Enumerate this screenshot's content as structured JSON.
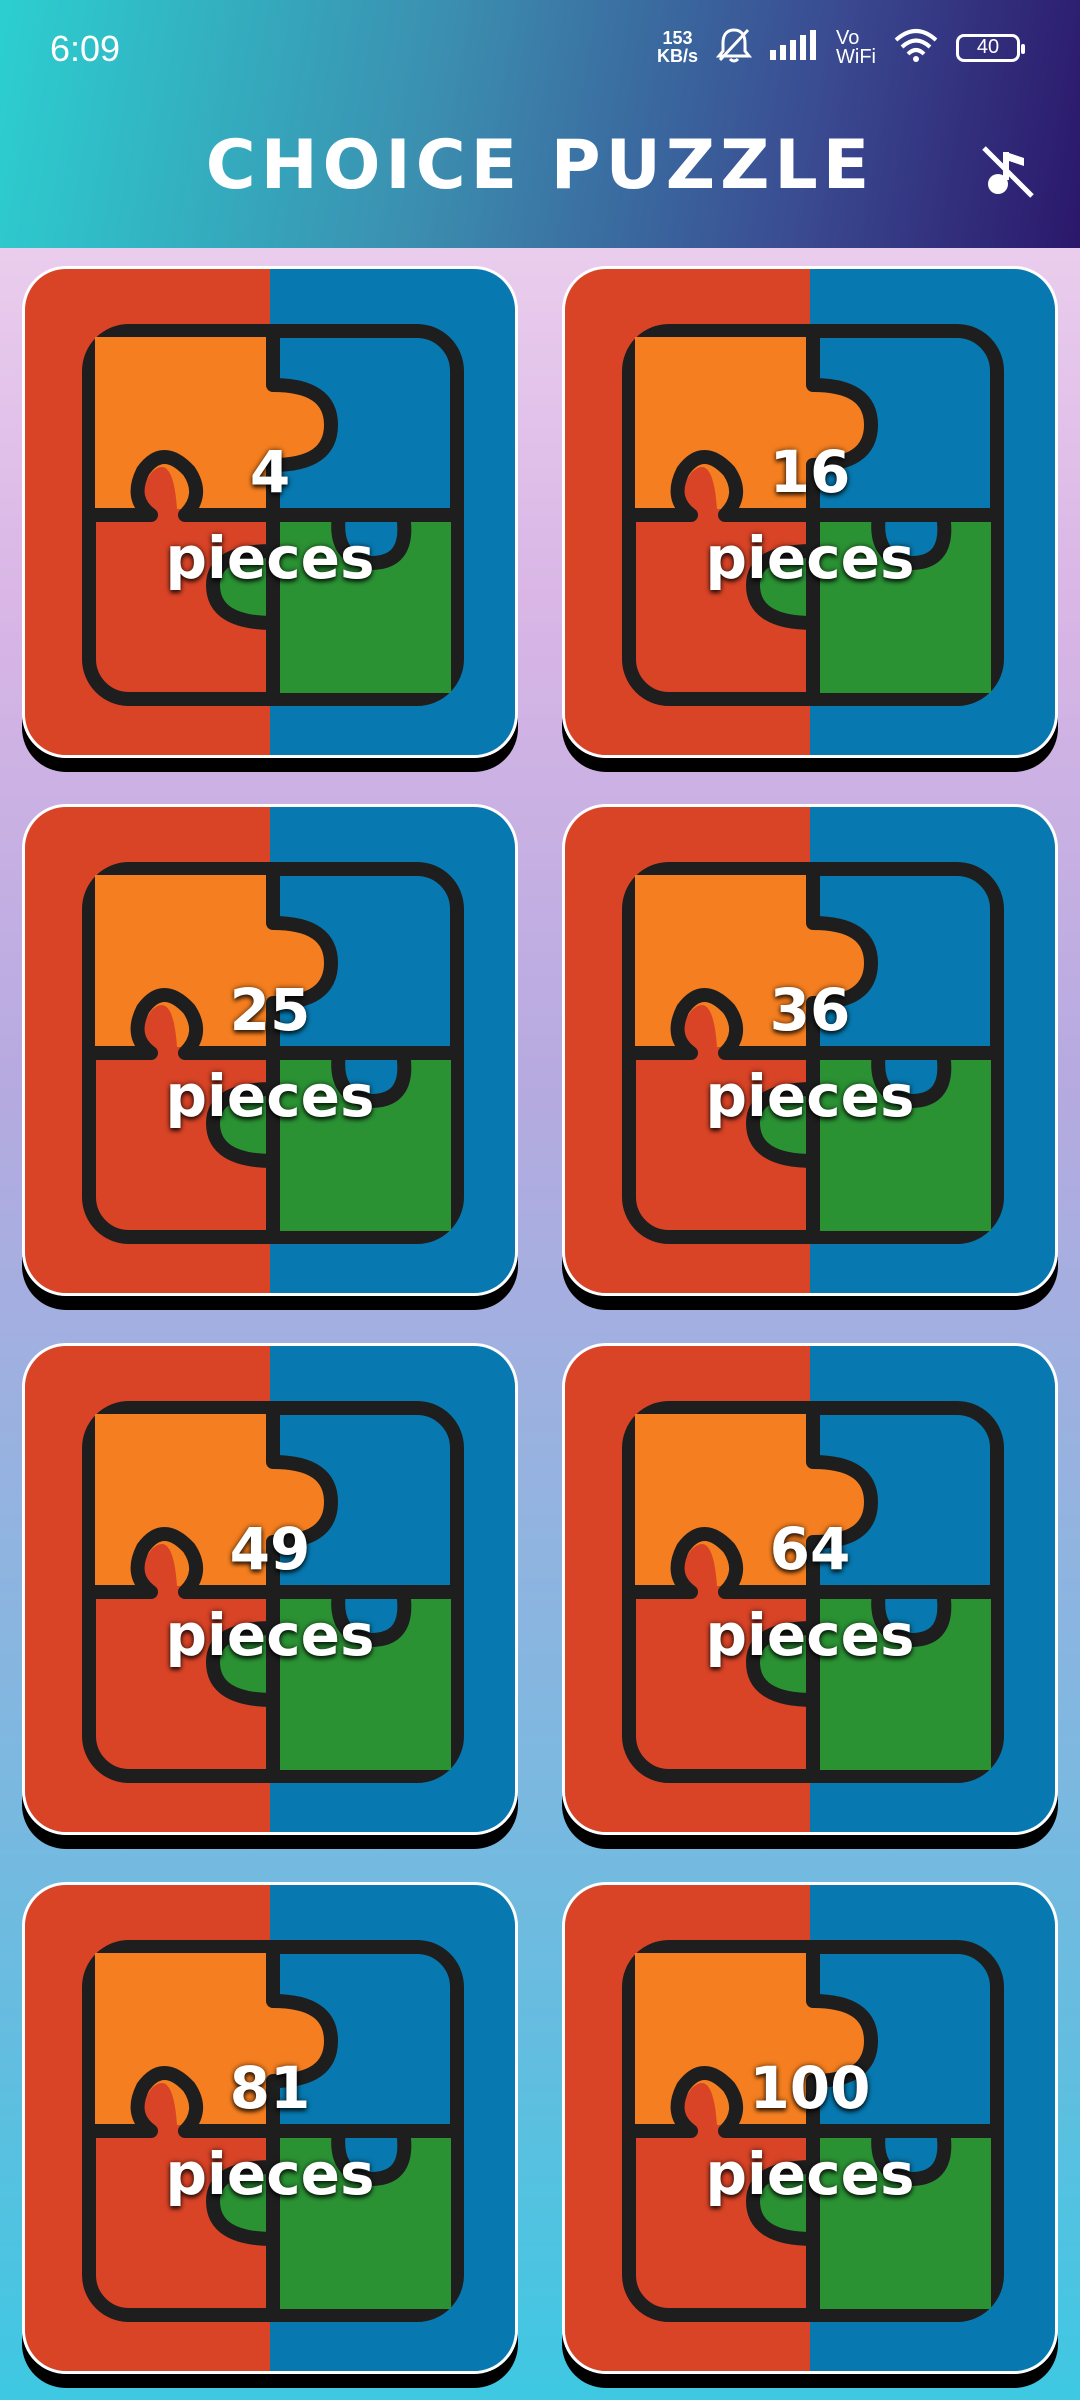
{
  "status_bar": {
    "time": "6:09",
    "net_speed_value": "153",
    "net_speed_unit": "KB/s",
    "vowifi_top": "Vo",
    "vowifi_bottom": "WiFi",
    "battery": "40"
  },
  "header": {
    "title": "CHOICE PUZZLE",
    "music_icon": "music-off-icon"
  },
  "tiles": [
    {
      "count": "4",
      "unit": "pieces"
    },
    {
      "count": "16",
      "unit": "pieces"
    },
    {
      "count": "25",
      "unit": "pieces"
    },
    {
      "count": "36",
      "unit": "pieces"
    },
    {
      "count": "49",
      "unit": "pieces"
    },
    {
      "count": "64",
      "unit": "pieces"
    },
    {
      "count": "81",
      "unit": "pieces"
    },
    {
      "count": "100",
      "unit": "pieces"
    }
  ],
  "colors": {
    "tile_left": "#d94427",
    "tile_right": "#0779b0",
    "piece_orange": "#f57f20",
    "piece_green": "#2b9234",
    "outline": "#1e1e1e"
  }
}
